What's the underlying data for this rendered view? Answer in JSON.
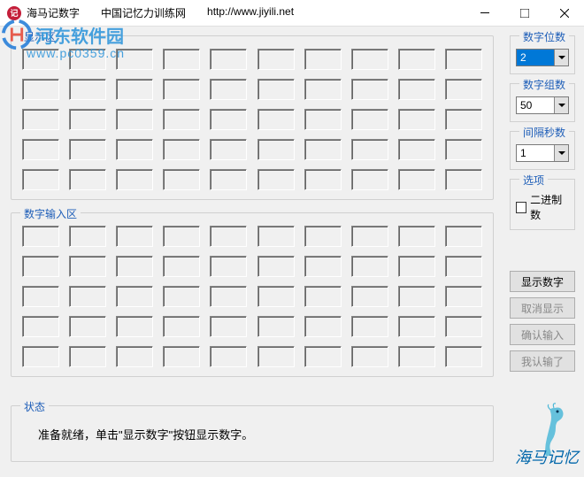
{
  "titlebar": {
    "app_name": "海马记数字",
    "site_name": "中国记忆力训练网",
    "url": "http://www.jiyili.net"
  },
  "watermark": {
    "line1": "河东软件园",
    "line2": "www.pc0359.cn"
  },
  "sections": {
    "display_area": "显示区",
    "input_area": "数字输入区",
    "status_area": "状态"
  },
  "controls": {
    "digit_count": {
      "label": "数字位数",
      "value": "2"
    },
    "group_count": {
      "label": "数字组数",
      "value": "50"
    },
    "interval": {
      "label": "间隔秒数",
      "value": "1"
    },
    "options": {
      "label": "选项",
      "binary": "二进制数"
    }
  },
  "buttons": {
    "show": "显示数字",
    "cancel": "取消显示",
    "confirm": "确认输入",
    "giveup": "我认输了"
  },
  "status_text": "准备就绪，单击\"显示数字\"按钮显示数字。",
  "brand": "海马记忆",
  "grid": {
    "rows": 5,
    "cols": 10
  }
}
